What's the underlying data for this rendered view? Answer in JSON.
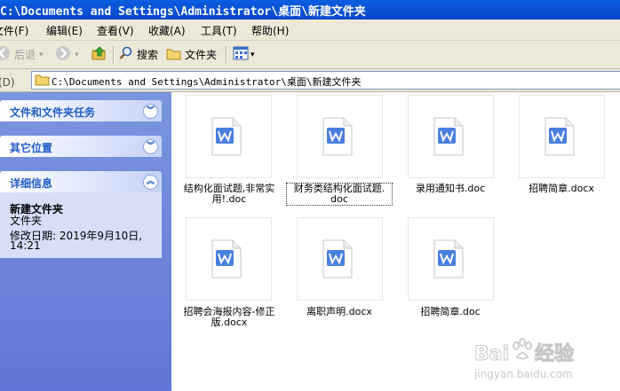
{
  "window": {
    "title": "C:\\Documents and Settings\\Administrator\\桌面\\新建文件夹"
  },
  "menu": [
    {
      "label": "文件(F)"
    },
    {
      "label": "编辑(E)"
    },
    {
      "label": "查看(V)"
    },
    {
      "label": "收藏(A)"
    },
    {
      "label": "工具(T)"
    },
    {
      "label": "帮助(H)"
    }
  ],
  "toolbar": {
    "back_label": "后退",
    "search_label": "搜索",
    "folders_label": "文件夹"
  },
  "address": {
    "label": "址(D)",
    "value": "C:\\Documents and Settings\\Administrator\\桌面\\新建文件夹"
  },
  "taskpane": {
    "panels": [
      {
        "title": "文件和文件夹任务",
        "state": "collapsed"
      },
      {
        "title": "其它位置",
        "state": "collapsed"
      },
      {
        "title": "详细信息",
        "state": "expanded"
      }
    ],
    "details": {
      "name": "新建文件夹",
      "type": "文件夹",
      "modified_line1": "修改日期: 2019年9月10日,",
      "modified_line2": "14:21"
    }
  },
  "files": [
    {
      "line1": "结构化面试题,非常实",
      "line2": "用!.doc",
      "selected": false
    },
    {
      "line1": "财务类结构化面试题.",
      "line2": "doc",
      "selected": true
    },
    {
      "line1": "录用通知书.doc",
      "line2": "",
      "selected": false
    },
    {
      "line1": "招聘简章.docx",
      "line2": "",
      "selected": false
    },
    {
      "line1": "招聘会海报内容-修正",
      "line2": "版.docx",
      "selected": false
    },
    {
      "line1": "离职声明.docx",
      "line2": "",
      "selected": false
    },
    {
      "line1": "招聘简章.doc",
      "line2": "",
      "selected": false
    }
  ],
  "watermark": {
    "text_main": "Baidu 经验",
    "text_sub": "jingyan.baidu.com"
  },
  "colors": {
    "titlebar": "#0a54d6",
    "taskpane": "#7a96df",
    "wps_icon": "#4a7fe0"
  }
}
